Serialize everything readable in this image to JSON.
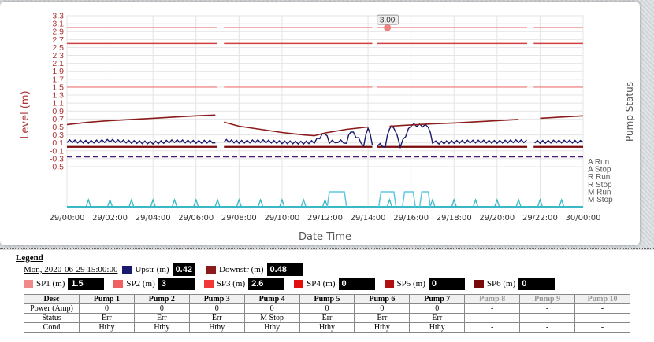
{
  "chart_data": {
    "type": "line",
    "ylabel": "Level (m)",
    "y2label": "Pump Status",
    "xlabel": "Date Time",
    "ylim": [
      -0.5,
      3.3
    ],
    "yticks": [
      "3.3",
      "3.1",
      "2.9",
      "2.7",
      "2.5",
      "2.3",
      "2.1",
      "1.9",
      "1.7",
      "1.5",
      "1.3",
      "1.1",
      "0.9",
      "0.7",
      "0.5",
      "0.3",
      "0.1",
      "-0.1",
      "-0.3",
      "-0.5"
    ],
    "y2ticks": [
      "A Run",
      "A Stop",
      "R Run",
      "R Stop",
      "M Run",
      "M Stop"
    ],
    "xticks": [
      "29/00:00",
      "29/02:00",
      "29/04:00",
      "29/06:00",
      "29/08:00",
      "29/10:00",
      "29/12:00",
      "29/14:00",
      "29/16:00",
      "29/18:00",
      "29/20:00",
      "29/22:00",
      "30/00:00"
    ],
    "tooltip": "3.00",
    "setpoints": [
      3.0,
      2.6,
      1.5,
      0.0
    ],
    "dashed_level": -0.25,
    "series": [
      {
        "name": "Downstr (m)",
        "color": "#8b1a1a",
        "x": [
          0,
          1,
          2,
          3,
          4,
          5,
          6,
          6.9,
          7.3,
          8,
          9,
          10,
          11,
          11.5,
          12,
          13,
          14,
          15,
          16,
          17,
          18,
          19,
          20,
          21,
          22,
          23,
          24
        ],
        "y": [
          0.56,
          0.62,
          0.66,
          0.69,
          0.72,
          0.75,
          0.78,
          0.8,
          0.62,
          0.52,
          0.44,
          0.36,
          0.3,
          0.28,
          0.35,
          0.44,
          0.5,
          0.52,
          0.55,
          0.58,
          0.6,
          0.63,
          0.66,
          0.69,
          0.72,
          0.75,
          0.78
        ]
      },
      {
        "name": "Upstr (m)",
        "color": "#1a1a6e",
        "x": [
          0,
          1,
          2,
          3,
          4,
          5,
          6,
          6.9,
          7.3,
          8,
          9,
          10,
          11,
          11.5,
          12,
          12.2,
          12.6,
          13,
          13.2,
          13.8,
          14,
          14.2,
          14.8,
          15,
          15.2,
          15.5,
          16,
          16.8,
          17,
          17.3,
          18,
          19,
          20,
          21,
          22,
          23,
          24
        ],
        "y": [
          0.14,
          0.12,
          0.15,
          0.12,
          0.1,
          0.14,
          0.12,
          0.13,
          0.15,
          0.12,
          0.14,
          0.11,
          0.1,
          0.12,
          0.35,
          0.12,
          0.14,
          0.12,
          0.4,
          0.05,
          0.5,
          0.08,
          0.02,
          0.48,
          0.5,
          0.02,
          0.55,
          0.52,
          0.12,
          0.1,
          0.12,
          0.13,
          0.12,
          0.14,
          0.12,
          0.13,
          0.12
        ]
      }
    ],
    "pump_spikes": [
      1,
      2,
      3,
      4,
      5,
      6,
      7,
      8,
      9,
      10,
      11,
      12,
      15,
      17,
      18,
      19,
      20,
      21,
      22,
      23
    ]
  },
  "legend": {
    "title": "Legend",
    "timestamp": "Mon, 2020-06-29 15:00:00",
    "upstr_label": "Upstr (m)",
    "upstr_value": "0.42",
    "upstr_color": "#1a1a6e",
    "downstr_label": "Downstr (m)",
    "downstr_value": "0.48",
    "downstr_color": "#8b1a1a",
    "setpoints": [
      {
        "label": "SP1 (m)",
        "value": "1.5",
        "color": "#f08a8a"
      },
      {
        "label": "SP2 (m)",
        "value": "3",
        "color": "#f06060"
      },
      {
        "label": "SP3 (m)",
        "value": "2.6",
        "color": "#f03838"
      },
      {
        "label": "SP4 (m)",
        "value": "0",
        "color": "#e01010"
      },
      {
        "label": "SP5 (m)",
        "value": "0",
        "color": "#b01010"
      },
      {
        "label": "SP6 (m)",
        "value": "0",
        "color": "#7a0a0a"
      }
    ]
  },
  "pump_table": {
    "headers": [
      "Desc",
      "Pump 1",
      "Pump 2",
      "Pump 3",
      "Pump 4",
      "Pump 5",
      "Pump 6",
      "Pump 7",
      "Pump 8",
      "Pump 9",
      "Pump 10"
    ],
    "rows": [
      [
        "Power (Amp)",
        "0",
        "0",
        "0",
        "0",
        "0",
        "0",
        "0",
        "-",
        "-",
        "-"
      ],
      [
        "Status",
        "Err",
        "Err",
        "Err",
        "M Stop",
        "Err",
        "Err",
        "Err",
        "-",
        "-",
        "-"
      ],
      [
        "Cond",
        "Hthy",
        "Hthy",
        "Hthy",
        "Hthy",
        "Hthy",
        "Hthy",
        "Hthy",
        "-",
        "-",
        "-"
      ]
    ]
  }
}
